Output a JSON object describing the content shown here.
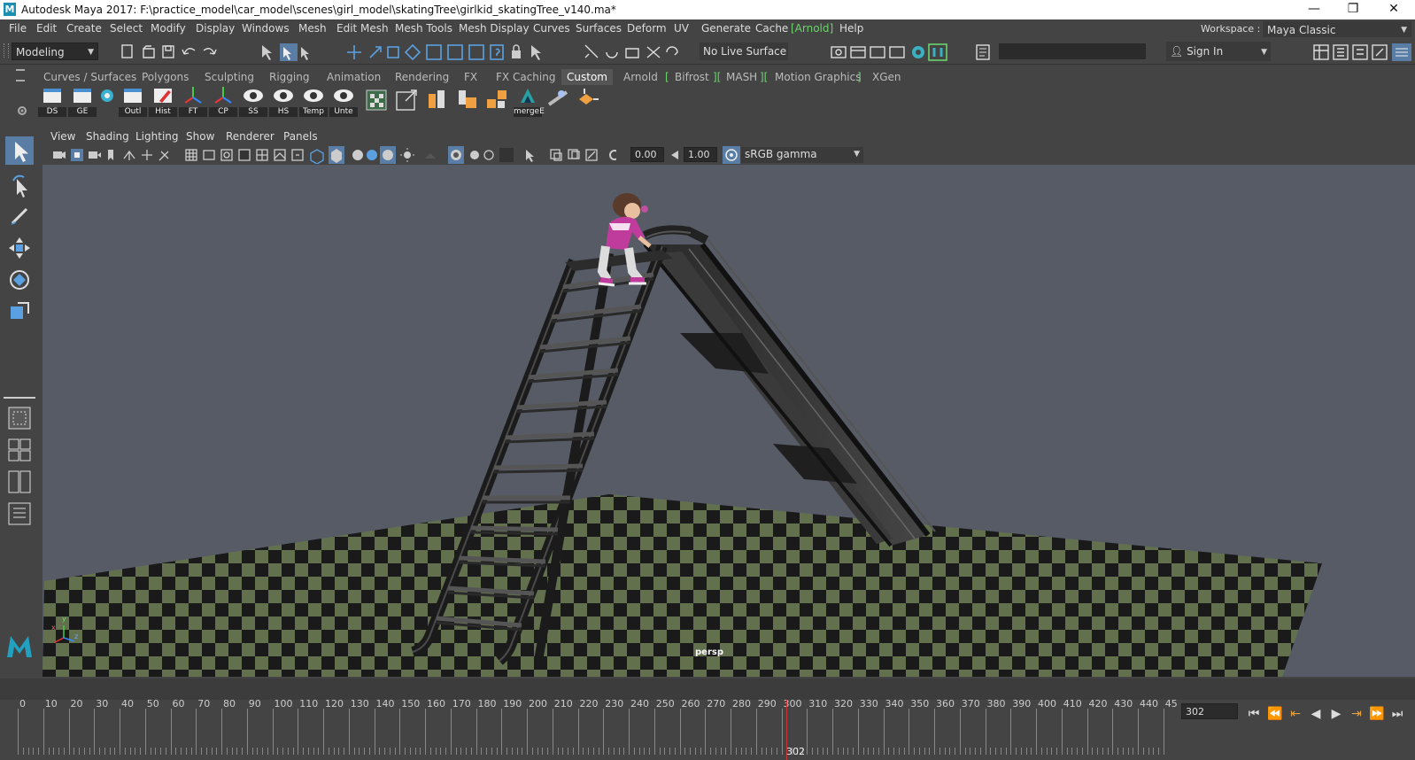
{
  "window": {
    "title": "Autodesk Maya 2017: F:\\practice_model\\car_model\\scenes\\girl_model\\skatingTree\\girlkid_skatingTree_v140.ma*",
    "controls": [
      "—",
      "❐",
      "✕"
    ]
  },
  "menubar": {
    "items": [
      "File",
      "Edit",
      "Create",
      "Select",
      "Modify",
      "Display",
      "Windows",
      "Mesh",
      "Edit Mesh",
      "Mesh Tools",
      "Mesh Display",
      "Curves",
      "Surfaces",
      "Deform",
      "UV",
      "Generate",
      "Cache",
      "[Arnold]",
      "Help"
    ],
    "workspace_label": "Workspace :",
    "workspace_value": "Maya Classic"
  },
  "statusline": {
    "mode": "Modeling",
    "live_surface": "No Live Surface",
    "sign_in": "Sign In"
  },
  "shelf_tabs": {
    "items": [
      "Curves / Surfaces",
      "Polygons",
      "Sculpting",
      "Rigging",
      "Animation",
      "Rendering",
      "FX",
      "FX Caching",
      "Custom",
      "Arnold",
      "Bifrost",
      "MASH",
      "Motion Graphics",
      "XGen"
    ],
    "active": "Custom"
  },
  "shelf": {
    "buttons": [
      {
        "label": "DS",
        "icon": "window-icon"
      },
      {
        "label": "GE",
        "icon": "window-icon"
      },
      {
        "label": "",
        "icon": "circle-icon"
      },
      {
        "label": "Outl",
        "icon": "window-icon"
      },
      {
        "label": "Hist",
        "icon": "pencil-icon"
      },
      {
        "label": "FT",
        "icon": "axes-icon"
      },
      {
        "label": "CP",
        "icon": "axes-icon"
      },
      {
        "label": "SS",
        "icon": "eye-icon"
      },
      {
        "label": "HS",
        "icon": "eye-icon"
      },
      {
        "label": "Temp",
        "icon": "eye-icon"
      },
      {
        "label": "Unte",
        "icon": "eye-icon"
      },
      {
        "label": "",
        "icon": "checker-icon"
      },
      {
        "label": "",
        "icon": "pivot-icon"
      },
      {
        "label": "",
        "icon": "blocks-icon"
      },
      {
        "label": "",
        "icon": "blocks-icon"
      },
      {
        "label": "",
        "icon": "blocks-icon"
      },
      {
        "label": "mergeE",
        "icon": "merge-icon"
      },
      {
        "label": "",
        "icon": "link-icon"
      },
      {
        "label": "",
        "icon": "arrows-icon"
      }
    ]
  },
  "panel_menu": {
    "items": [
      "View",
      "Shading",
      "Lighting",
      "Show",
      "Renderer",
      "Panels"
    ]
  },
  "panel_toolbar": {
    "exposure": "0.00",
    "gamma": "1.00",
    "color_space": "sRGB gamma"
  },
  "viewport": {
    "camera_label": "persp",
    "axis_labels": [
      "x",
      "y",
      "z"
    ]
  },
  "timeline": {
    "ticks": [
      "0",
      "10",
      "20",
      "30",
      "40",
      "50",
      "60",
      "70",
      "80",
      "90",
      "100",
      "110",
      "120",
      "130",
      "140",
      "150",
      "160",
      "170",
      "180",
      "190",
      "200",
      "210",
      "220",
      "230",
      "240",
      "250",
      "260",
      "270",
      "280",
      "290",
      "300",
      "310",
      "320",
      "330",
      "340",
      "350",
      "360",
      "370",
      "380",
      "390",
      "400",
      "410",
      "420",
      "430",
      "440",
      "45"
    ],
    "current_frame": "302",
    "current_frame_field": "302",
    "playback_buttons": [
      "⏮",
      "⏪",
      "⇤",
      "◀",
      "▶",
      "⇥",
      "⏩",
      "⏭"
    ]
  },
  "colors": {
    "ui_bg": "#444444",
    "viewport_bg": "#565b66",
    "accent_green": "#6bd36b",
    "checker_green": "#6b7a55",
    "checker_dark": "#1d1d1d",
    "slide_dark": "#2e2e2e"
  }
}
